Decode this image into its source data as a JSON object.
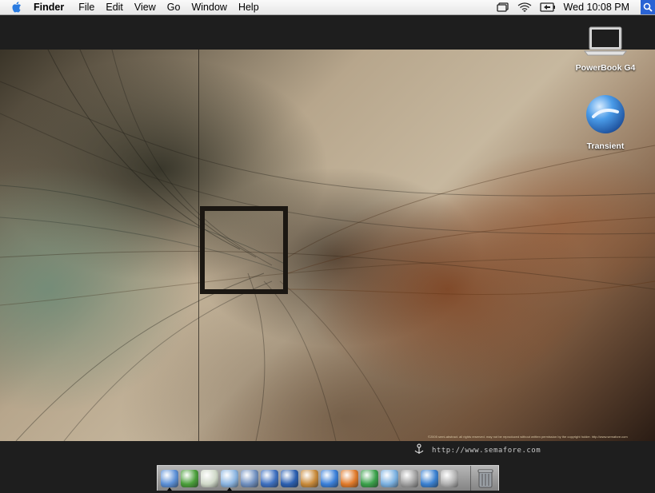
{
  "menubar": {
    "app_name": "Finder",
    "items": [
      "File",
      "Edit",
      "View",
      "Go",
      "Window",
      "Help"
    ],
    "clock": "Wed 10:08 PM",
    "status_icons": [
      "display-mirroring-icon",
      "wifi-icon",
      "battery-icon"
    ]
  },
  "desktop": {
    "icons": [
      {
        "label": "PowerBook G4",
        "icon": "laptop-icon"
      },
      {
        "label": "Transient",
        "icon": "disk-image-icon"
      }
    ]
  },
  "wallpaper": {
    "url": "http://www.semafore.com",
    "caption": "©2005 semi-abstract. all rights reserved. may not be reproduced without written permission by the copyright holder.  http://www.semafore.com"
  },
  "dock": {
    "items": [
      {
        "name": "finder",
        "color": "#5b8fd6",
        "running": true
      },
      {
        "name": "ichat",
        "color": "#4a9e3a",
        "running": false
      },
      {
        "name": "itunes",
        "color": "#cfd8c8",
        "running": false
      },
      {
        "name": "safari",
        "color": "#8ab4e0",
        "running": true
      },
      {
        "name": "iphoto",
        "color": "#6f8fbf",
        "running": false
      },
      {
        "name": "imovie",
        "color": "#3d6fbf",
        "running": false
      },
      {
        "name": "idvd",
        "color": "#2b5fb0",
        "running": false
      },
      {
        "name": "garageband",
        "color": "#c88a3a",
        "running": false
      },
      {
        "name": "word",
        "color": "#3a7fd8",
        "running": false
      },
      {
        "name": "powerpoint",
        "color": "#e07a2a",
        "running": false
      },
      {
        "name": "excel",
        "color": "#3aa04a",
        "running": false
      },
      {
        "name": "dashboard",
        "color": "#7ab0e0",
        "running": false
      },
      {
        "name": "automator",
        "color": "#a0a0a0",
        "running": false
      },
      {
        "name": "quicktime",
        "color": "#3a80d0",
        "running": false
      },
      {
        "name": "system-preferences",
        "color": "#b0b0b0",
        "running": false
      }
    ],
    "trash": "trash-icon"
  },
  "colors": {
    "menubar_bg": "#f0f0f0",
    "desktop_bg": "#1e1e1e",
    "spotlight": "#2a63d4"
  }
}
